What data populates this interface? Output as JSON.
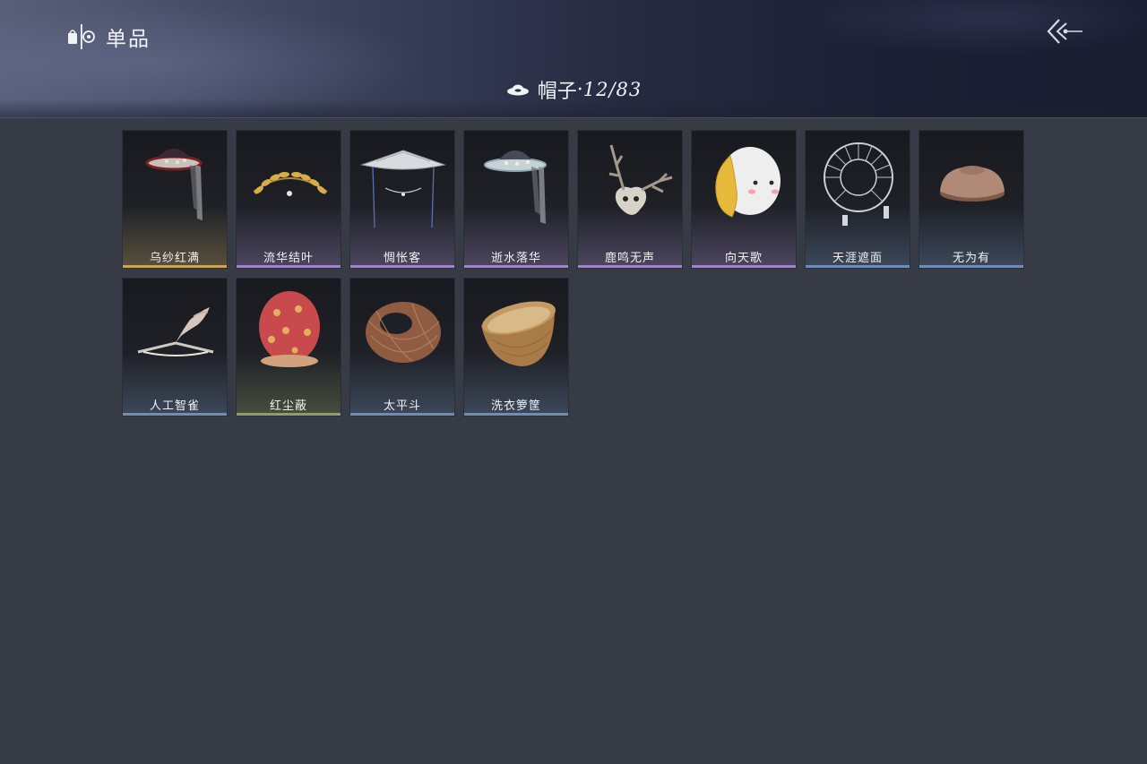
{
  "header": {
    "section_title": "单品",
    "section_icon": "wardrobe-icon",
    "back_icon": "back-arrow-icon"
  },
  "category": {
    "icon": "hat-icon",
    "name": "帽子",
    "separator": "·",
    "count": "12/83"
  },
  "rarity_colors": {
    "gold": "#c9a55a",
    "purple": "#9f86c4",
    "blue": "#6f8db5",
    "green": "#8ea05c"
  },
  "items": [
    {
      "name": "乌纱红满",
      "rarity": "gold",
      "icon": "veiled-hat-icon"
    },
    {
      "name": "流华结叶",
      "rarity": "purple",
      "icon": "golden-laurel-icon"
    },
    {
      "name": "惆怅客",
      "rarity": "purple",
      "icon": "conical-veil-hat-icon"
    },
    {
      "name": "逝水落华",
      "rarity": "purple",
      "icon": "jeweled-veil-hat-icon"
    },
    {
      "name": "鹿鸣无声",
      "rarity": "purple",
      "icon": "deer-skull-icon"
    },
    {
      "name": "向天歌",
      "rarity": "purple",
      "icon": "duck-hood-icon"
    },
    {
      "name": "天涯遮面",
      "rarity": "blue",
      "icon": "wire-cage-hat-icon"
    },
    {
      "name": "无为有",
      "rarity": "blue",
      "icon": "wooden-bowl-hat-icon"
    },
    {
      "name": "人工智雀",
      "rarity": "blue",
      "icon": "bird-figure-icon"
    },
    {
      "name": "红尘蔽",
      "rarity": "green",
      "icon": "red-hood-icon"
    },
    {
      "name": "太平斗",
      "rarity": "blue",
      "icon": "woven-basket-icon"
    },
    {
      "name": "洗衣箩筐",
      "rarity": "blue",
      "icon": "laundry-basket-icon"
    }
  ]
}
